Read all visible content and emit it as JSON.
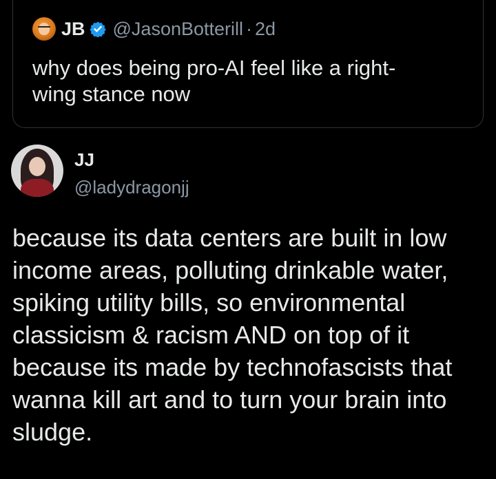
{
  "quoted_tweet": {
    "name": "JB",
    "verified": true,
    "handle": "@JasonBotterill",
    "separator": "·",
    "time": "2d",
    "text": "why does being pro-AI feel like a right-\nwing stance now"
  },
  "reply": {
    "name": "JJ",
    "handle": "@ladydragonjj",
    "text": "because its data centers are built in low\nincome areas, polluting drinkable water,\nspiking utility bills, so environmental\nclassicism & racism AND on top of it\nbecause its made by technofascists that\nwanna kill art and to turn your brain into\nsludge."
  },
  "colors": {
    "background": "#000000",
    "text_primary": "#e7e9ea",
    "text_secondary": "#8b98a5",
    "verified_badge": "#1d9bf0",
    "card_border": "#2f3336"
  },
  "icons": {
    "verified": "verified-badge-icon"
  }
}
